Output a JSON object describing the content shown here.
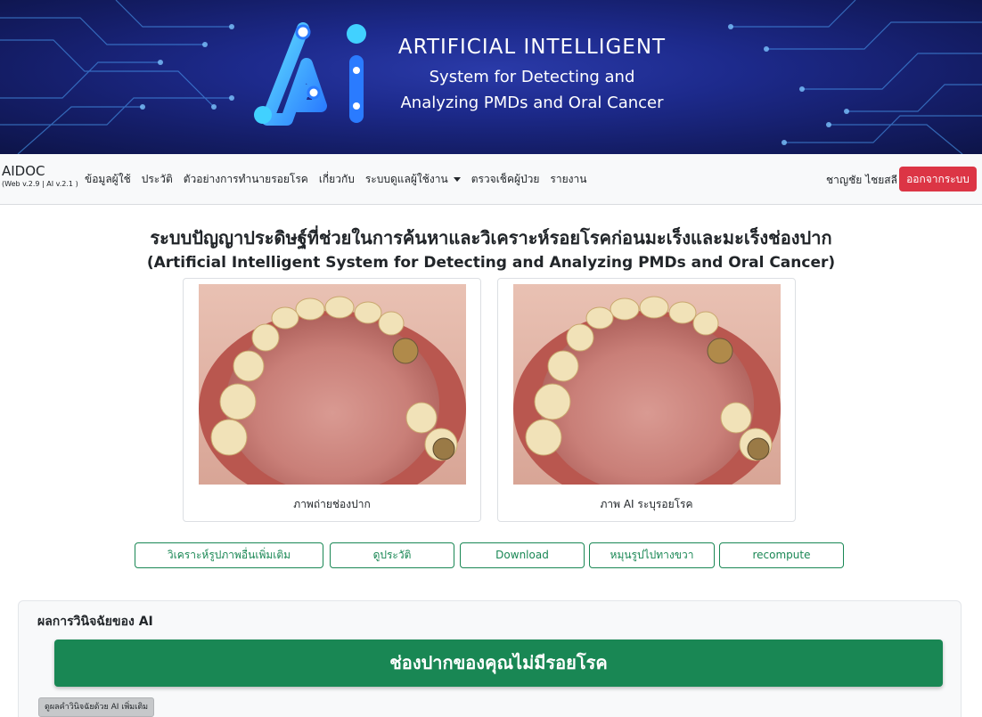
{
  "banner": {
    "title": "ARTIFICIAL INTELLIGENT",
    "subtitle_line1": "System for Detecting and",
    "subtitle_line2": "Analyzing PMDs and Oral Cancer",
    "logo": "ai-logo"
  },
  "navbar": {
    "brand": "AIDOC",
    "version": "(Web v.2.9 | AI v.2.1 )",
    "links": [
      {
        "label": "ข้อมูลผู้ใช้"
      },
      {
        "label": "ประวัติ"
      },
      {
        "label": "ตัวอย่างการทำนายรอยโรค"
      },
      {
        "label": "เกี่ยวกับ"
      },
      {
        "label": "ระบบดูแลผู้ใช้งาน",
        "dropdown": true
      },
      {
        "label": "ตรวจเช็คผู้ป่วย"
      },
      {
        "label": "รายงาน"
      }
    ],
    "user_name": "ชาญชัย ไชยสลี",
    "logout_label": "ออกจากระบบ",
    "logout_color": "#dc3545"
  },
  "main": {
    "title": "ระบบปัญญาประดิษฐ์ที่ช่วยในการค้นหาและวิเคราะห์รอยโรคก่อนมะเร็งและมะเร็งช่องปาก",
    "subtitle": "(Artificial Intelligent System for Detecting and Analyzing PMDs and Oral Cancer)",
    "images": [
      {
        "caption": "ภาพถ่ายช่องปาก"
      },
      {
        "caption": "ภาพ AI ระบุรอยโรค"
      }
    ],
    "actions": [
      {
        "label": "วิเคราะห์รูปภาพอื่นเพิ่มเติม"
      },
      {
        "label": "ดูประวัติ"
      },
      {
        "label": "Download"
      },
      {
        "label": "หมุนรูปไปทางขวา"
      },
      {
        "label": "recompute"
      }
    ],
    "accent_color": "#198754"
  },
  "result": {
    "title": "ผลการวินิจฉัยของ AI",
    "message": "ช่องปากของคุณไม่มีรอยโรค",
    "more_button": "ดูผลคำวินิจฉัยด้วย AI เพิ่มเติม"
  }
}
